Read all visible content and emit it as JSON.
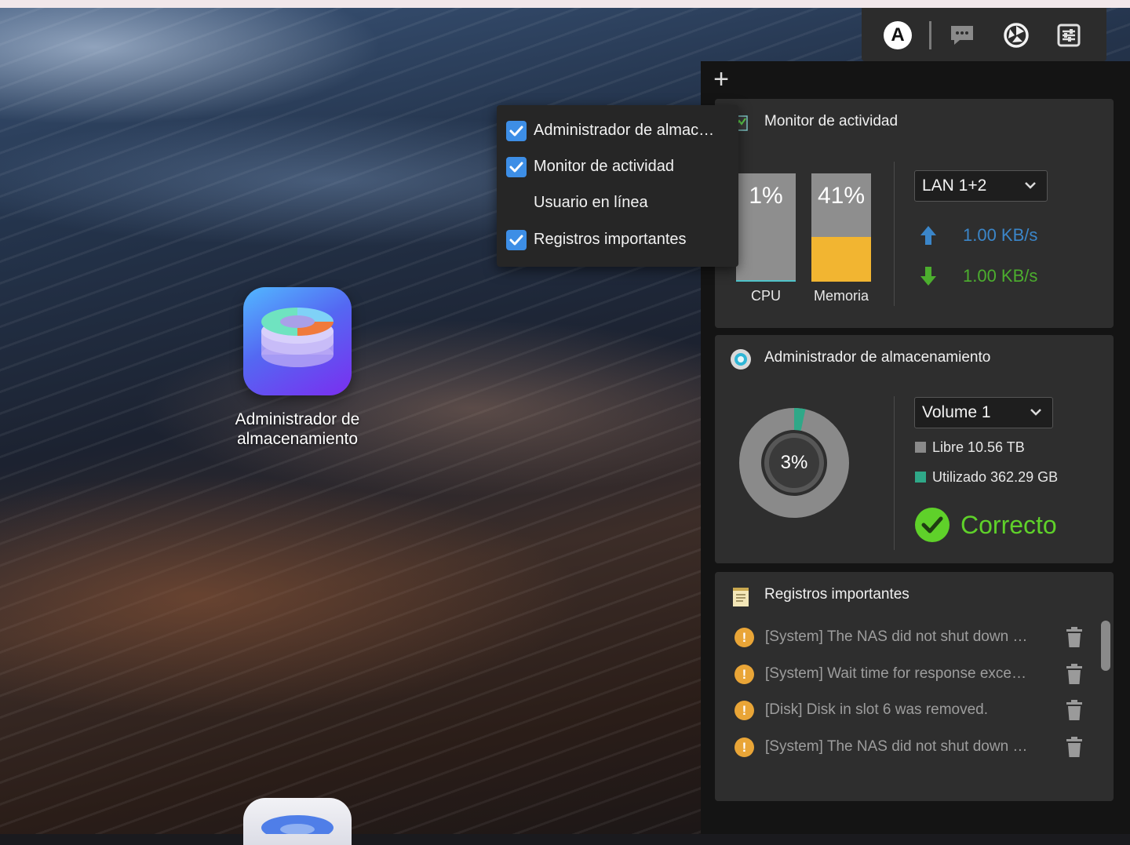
{
  "topbar": {
    "avatar_letter": "A",
    "icons": [
      "avatar-icon",
      "chat-icon",
      "dashboard-icon",
      "settings-sliders-icon"
    ]
  },
  "add_widget_label": "+",
  "widget_menu": {
    "items": [
      {
        "label": "Administrador de almac…",
        "checked": true
      },
      {
        "label": "Monitor de actividad",
        "checked": true
      },
      {
        "label": "Usuario en línea",
        "checked": false
      },
      {
        "label": "Registros importantes",
        "checked": true
      }
    ]
  },
  "desktop": {
    "app_label": "Administrador de almacenamiento"
  },
  "activity": {
    "title": "Monitor de actividad",
    "cpu": {
      "label": "CPU",
      "value": "1%",
      "fraction": 0.01
    },
    "memory": {
      "label": "Memoria",
      "value": "41%",
      "fraction": 0.41
    },
    "network": {
      "selected": "LAN 1+2",
      "upload": "1.00 KB/s",
      "download": "1.00 KB/s"
    },
    "colors": {
      "memory_fill": "#f2b531",
      "cpu_fill": "#4fc3c9",
      "upload": "#3b86c9",
      "download": "#4cae2e"
    }
  },
  "storage": {
    "title": "Administrador de almacenamiento",
    "used_percent_label": "3%",
    "used_fraction": 0.033,
    "volume_selected": "Volume 1",
    "free_label": "Libre 10.56 TB",
    "used_label": "Utilizado 362.29 GB",
    "status": "Correcto",
    "colors": {
      "free": "#8a8a8a",
      "used": "#2fa888",
      "status": "#5fd12a"
    }
  },
  "logs": {
    "title": "Registros importantes",
    "entries": [
      "[System] The NAS did not shut down …",
      "[System] Wait time for response exce…",
      "[Disk] Disk in slot 6 was removed.",
      "[System] The NAS did not shut down …"
    ]
  }
}
